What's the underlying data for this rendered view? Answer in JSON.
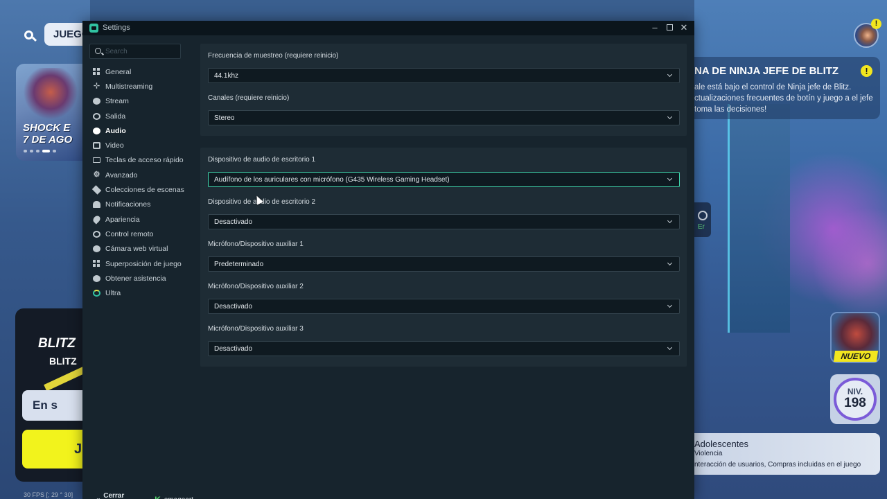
{
  "background": {
    "games_tab": "JUEGOS",
    "promo": {
      "text": "SHOCK E\n7 DE AGO"
    },
    "mode_card": {
      "title": "BLITZ",
      "subtitle": "BLITZ",
      "queue_label": "En s",
      "play_label": "J"
    },
    "banner": {
      "title": "NA DE NINJA JEFE DE BLITZ",
      "description": "ale está bajo el control de Ninja jefe de Blitz. ctualizaciones frecuentes de botín y juego a el jefe toma las decisiones!"
    },
    "xbox_label": "Er",
    "new_badge": "NUEVO",
    "level": {
      "label": "NIV.",
      "value": "198"
    },
    "rating": {
      "title": "Adolescentes",
      "violence": "Violencia",
      "notes": "nteracción de usuarios,  Compras incluidas en el juego"
    },
    "fps": "30 FPS [; 29 ° 30]"
  },
  "window": {
    "title": "Settings",
    "controls": {
      "minimize": "–",
      "close": "✕"
    }
  },
  "sidebar": {
    "search_placeholder": "Search",
    "items": [
      {
        "label": "General",
        "icon": "grid-icon",
        "active": false
      },
      {
        "label": "Multistreaming",
        "icon": "multistream-icon",
        "active": false
      },
      {
        "label": "Stream",
        "icon": "globe-icon",
        "active": false
      },
      {
        "label": "Salida",
        "icon": "output-icon",
        "active": false
      },
      {
        "label": "Audio",
        "icon": "speaker-icon",
        "active": true
      },
      {
        "label": "Video",
        "icon": "video-icon",
        "active": false
      },
      {
        "label": "Teclas de acceso rápido",
        "icon": "keyboard-icon",
        "active": false
      },
      {
        "label": "Avanzado",
        "icon": "advanced-icon",
        "active": false
      },
      {
        "label": "Colecciones de escenas",
        "icon": "scenes-icon",
        "active": false
      },
      {
        "label": "Notificaciones",
        "icon": "bell-icon",
        "active": false
      },
      {
        "label": "Apariencia",
        "icon": "appearance-icon",
        "active": false
      },
      {
        "label": "Control remoto",
        "icon": "remote-icon",
        "active": false
      },
      {
        "label": "Cámara web virtual",
        "icon": "webcam-icon",
        "active": false
      },
      {
        "label": "Superposición de juego",
        "icon": "overlay-icon",
        "active": false
      },
      {
        "label": "Obtener asistencia",
        "icon": "help-icon",
        "active": false
      },
      {
        "label": "Ultra",
        "icon": "ultra-icon",
        "active": false
      }
    ],
    "footer": {
      "logout_label": "Cerrar sesión",
      "username": "emagoart",
      "platform_glyph": "K"
    }
  },
  "audio": {
    "sample_rate": {
      "label": "Frecuencia de muestreo (requiere reinicio)",
      "value": "44.1khz"
    },
    "channels": {
      "label": "Canales (requiere reinicio)",
      "value": "Stereo"
    },
    "desktop1": {
      "label": "Dispositivo de audio de escritorio 1",
      "value": "Audífono de los auriculares con micrófono (G435 Wireless Gaming Headset)"
    },
    "desktop2": {
      "label": "Dispositivo de audio de escritorio 2",
      "value": "Desactivado"
    },
    "mic1": {
      "label": "Micrófono/Dispositivo auxiliar 1",
      "value": "Predeterminado"
    },
    "mic2": {
      "label": "Micrófono/Dispositivo auxiliar 2",
      "value": "Desactivado"
    },
    "mic3": {
      "label": "Micrófono/Dispositivo auxiliar 3",
      "value": "Desactivado"
    }
  },
  "colors": {
    "accent": "#31c3a2",
    "focus_border": "#41d7ae",
    "window_bg": "#17242d",
    "panel_bg": "#1e2c35",
    "input_bg": "#0f1a21"
  }
}
